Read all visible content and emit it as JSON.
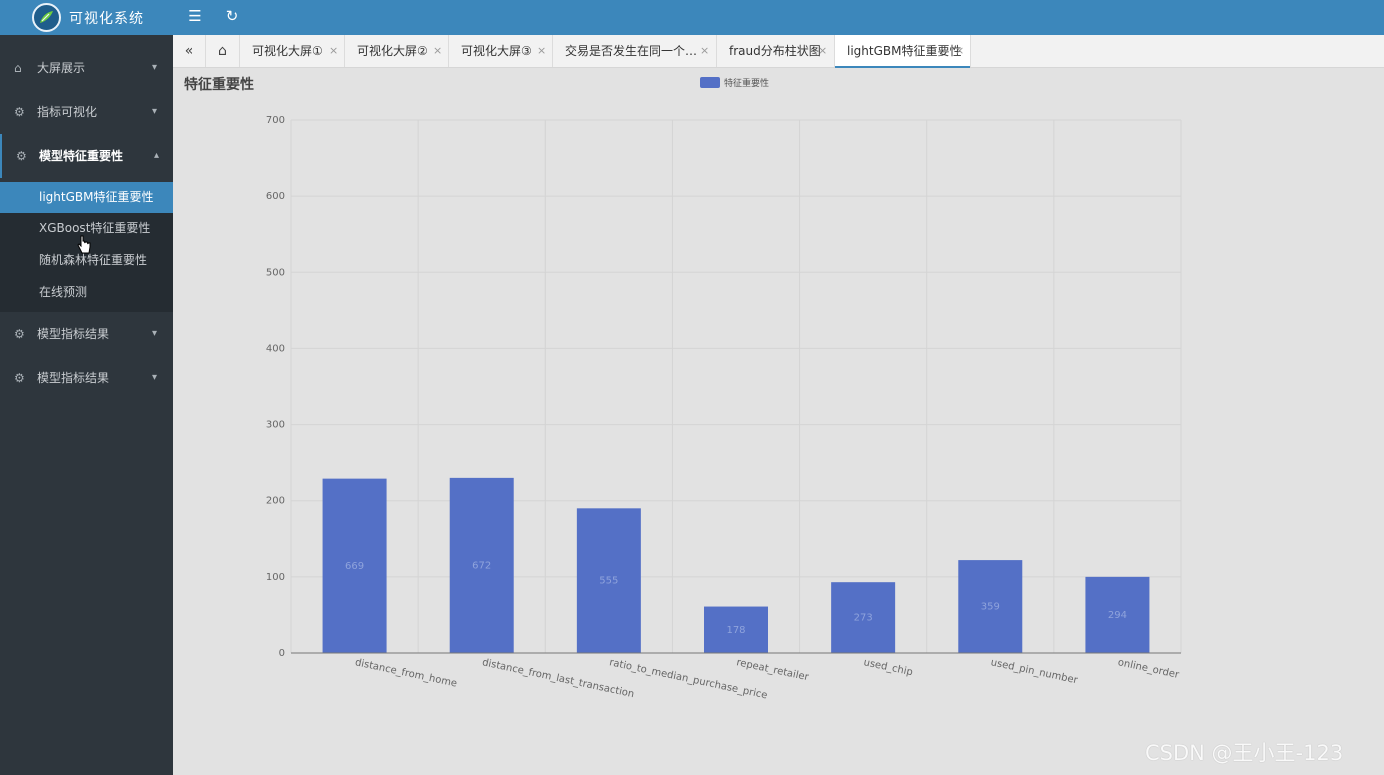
{
  "app": {
    "title": "可视化系统"
  },
  "sidebar": {
    "items": [
      {
        "label": "大屏展示",
        "icon": "home-icon"
      },
      {
        "label": "指标可视化",
        "icon": "gear-icon"
      },
      {
        "label": "模型特征重要性",
        "icon": "gear-icon"
      },
      {
        "label": "模型指标结果",
        "icon": "gear-icon"
      },
      {
        "label": "模型指标结果",
        "icon": "gear-icon"
      }
    ],
    "submenu": [
      {
        "label": "lightGBM特征重要性"
      },
      {
        "label": "XGBoost特征重要性"
      },
      {
        "label": "随机森林特征重要性"
      },
      {
        "label": "在线预测"
      }
    ]
  },
  "tabs": [
    {
      "label": "可视化大屏①"
    },
    {
      "label": "可视化大屏②"
    },
    {
      "label": "可视化大屏③"
    },
    {
      "label": "交易是否发生在同一个…"
    },
    {
      "label": "fraud分布柱状图"
    },
    {
      "label": "lightGBM特征重要性"
    }
  ],
  "page": {
    "title": "特征重要性"
  },
  "watermark": "CSDN @王小王-123",
  "colors": {
    "topbar": "#3c87bb",
    "sidebar": "#2e363d",
    "bar": "#5470c6"
  },
  "chart_data": {
    "type": "bar",
    "categories": [
      "distance_from_home",
      "distance_from_last_transaction",
      "ratio_to_median_purchase_price",
      "repeat_retailer",
      "used_chip",
      "used_pin_number",
      "online_order"
    ],
    "series": [
      {
        "name": "特征重要性",
        "values": [
          229,
          230,
          190,
          61,
          93,
          122,
          100
        ],
        "labels": [
          "669",
          "672",
          "555",
          "178",
          "273",
          "359",
          "294"
        ]
      }
    ],
    "ylim": [
      0,
      700
    ],
    "yticks": [
      "0",
      "100",
      "200",
      "300",
      "400",
      "500",
      "600",
      "700"
    ],
    "grid": true,
    "legend": "top-center"
  }
}
